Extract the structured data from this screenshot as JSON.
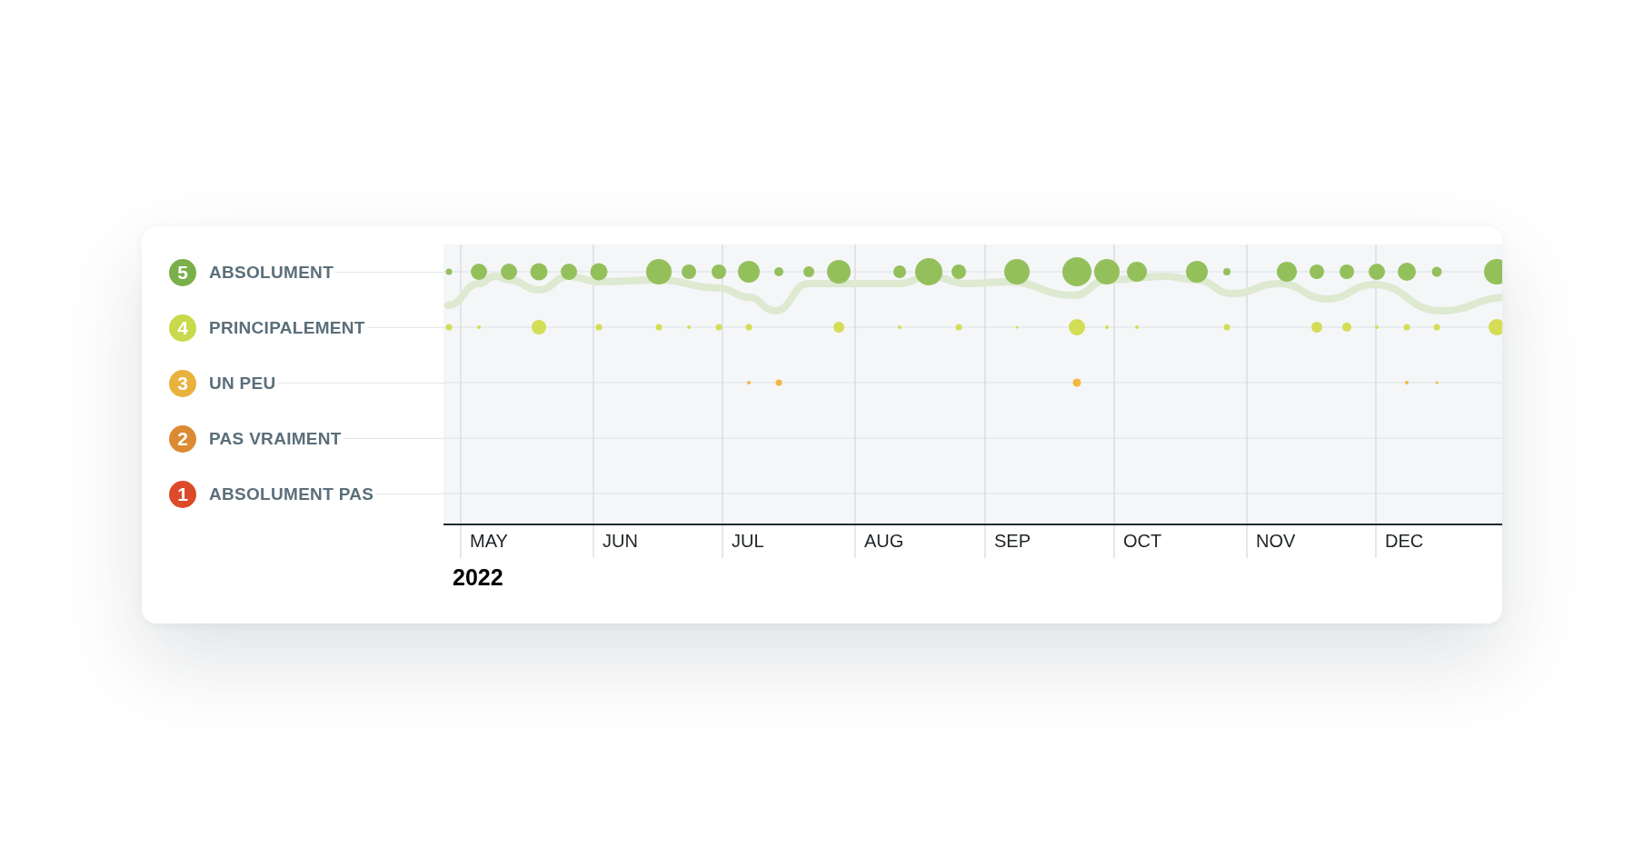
{
  "legend": [
    {
      "number": "5",
      "label": "ABSOLUMENT",
      "color": "#7ab04a"
    },
    {
      "number": "4",
      "label": "PRINCIPALEMENT",
      "color": "#c9d94c"
    },
    {
      "number": "3",
      "label": "UN PEU",
      "color": "#e8b23c"
    },
    {
      "number": "2",
      "label": "PAS VRAIMENT",
      "color": "#dc8a32"
    },
    {
      "number": "1",
      "label": "ABSOLUMENT PAS",
      "color": "#dc4a2a"
    }
  ],
  "months": [
    "MAY",
    "JUN",
    "JUL",
    "AUG",
    "SEP",
    "OCT",
    "NOV",
    "DEC"
  ],
  "year": "2022"
}
